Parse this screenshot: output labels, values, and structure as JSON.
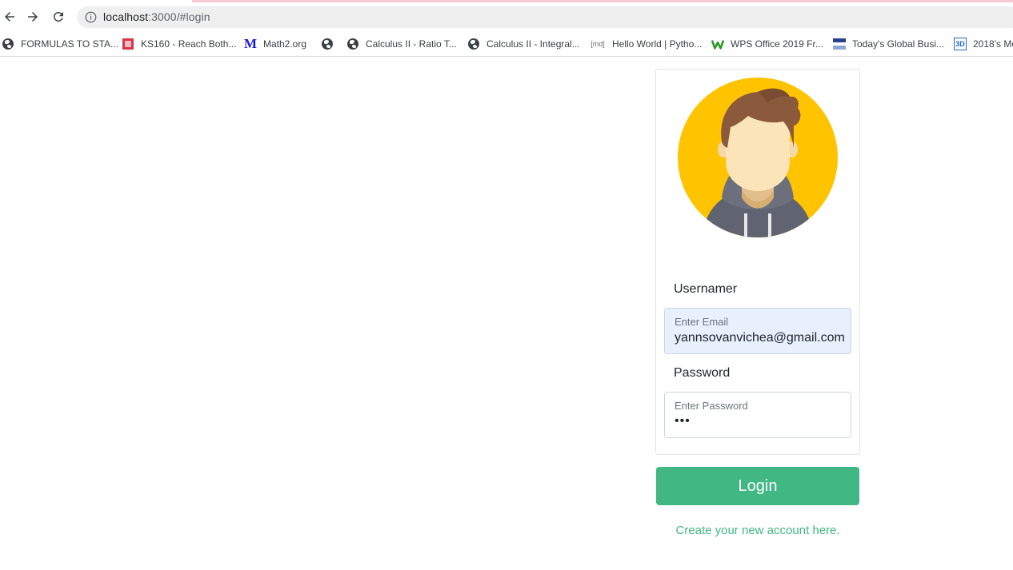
{
  "browser": {
    "url_host": "localhost",
    "url_rest": ":3000/#login",
    "bookmarks": [
      {
        "label": "FORMULAS TO STA...",
        "icon": "globe-icon"
      },
      {
        "label": "KS160 - Reach Both...",
        "icon": "ks160-icon"
      },
      {
        "label": "Math2.org",
        "icon": "math2-m-icon"
      },
      {
        "label": "",
        "icon": "globe-icon"
      },
      {
        "label": "Calculus II - Ratio T...",
        "icon": "globe-icon"
      },
      {
        "label": "Calculus II - Integral...",
        "icon": "globe-icon"
      },
      {
        "label": "Hello World | Pytho...",
        "icon": "md-icon"
      },
      {
        "label": "WPS Office 2019 Fr...",
        "icon": "wps-icon"
      },
      {
        "label": "Today's Global Busi...",
        "icon": "flag-icon"
      },
      {
        "label": "2018's Mo",
        "icon": "3d-icon"
      }
    ]
  },
  "login": {
    "username_label": "Usernamer",
    "email_placeholder": "Enter Email",
    "email_value": "yannsovanvichea@gmail.com",
    "password_label": "Password",
    "password_placeholder": "Enter Password",
    "password_value": "•••",
    "login_button": "Login",
    "create_account": "Create your new account here."
  },
  "colors": {
    "accent": "#41b883",
    "avatar_bg": "#ffc107",
    "autofill_bg": "#e8f0fe"
  }
}
